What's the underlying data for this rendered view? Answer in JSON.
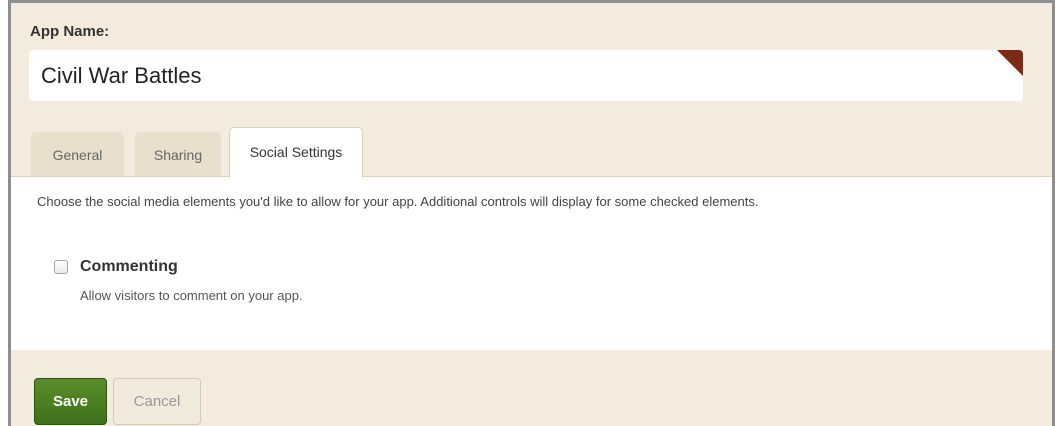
{
  "app_name": {
    "label": "App Name:",
    "value": "Civil War Battles"
  },
  "tabs": [
    {
      "label": "General",
      "active": false
    },
    {
      "label": "Sharing",
      "active": false
    },
    {
      "label": "Social Settings",
      "active": true
    }
  ],
  "social_settings": {
    "intro": "Choose the social media elements you'd like to allow for your app. Additional controls will display for some checked elements.",
    "options": [
      {
        "label": "Commenting",
        "description": "Allow visitors to comment on your app.",
        "checked": false
      }
    ]
  },
  "actions": {
    "save_label": "Save",
    "cancel_label": "Cancel"
  },
  "colors": {
    "background": "#f3ecde",
    "save_button": "#4a7d22",
    "corner_flag": "#7b2a16"
  }
}
